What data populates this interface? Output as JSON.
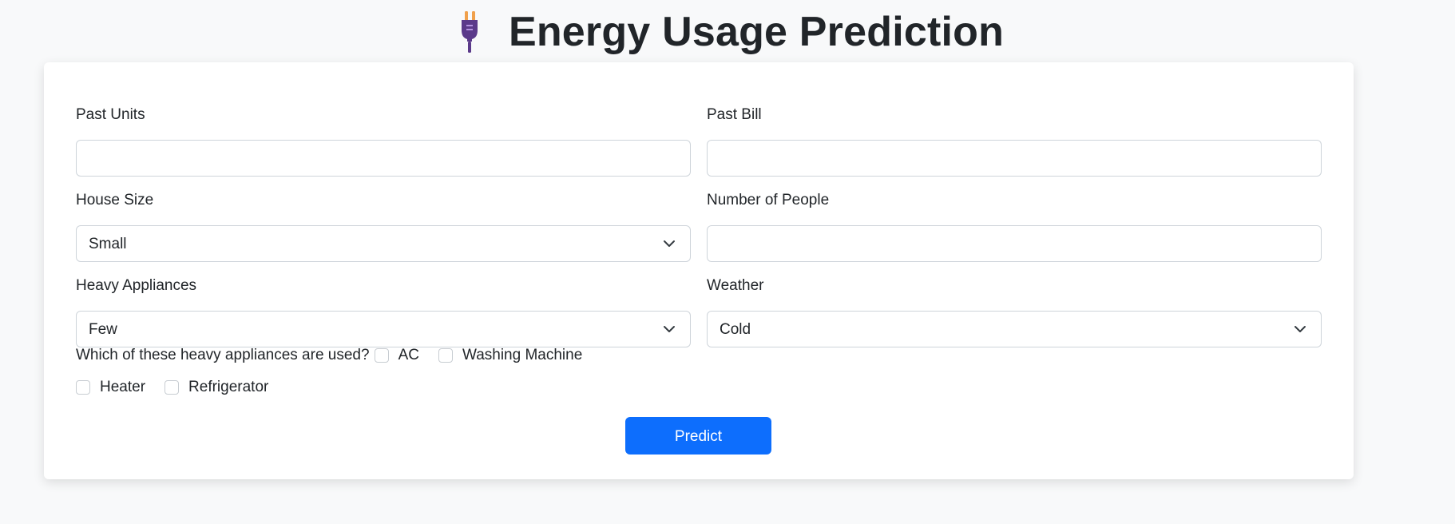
{
  "header": {
    "title": "Energy Usage Prediction",
    "icon": "plug-icon"
  },
  "form": {
    "past_units": {
      "label": "Past Units",
      "value": ""
    },
    "past_bill": {
      "label": "Past Bill",
      "value": ""
    },
    "house_size": {
      "label": "House Size",
      "selected": "Small"
    },
    "number_of_people": {
      "label": "Number of People",
      "value": ""
    },
    "heavy_appliances": {
      "label": "Heavy Appliances",
      "selected": "Few"
    },
    "weather": {
      "label": "Weather",
      "selected": "Cold"
    },
    "appliances_question": "Which of these heavy appliances are used?",
    "appliances": [
      {
        "label": "AC",
        "checked": false
      },
      {
        "label": "Washing Machine",
        "checked": false
      },
      {
        "label": "Heater",
        "checked": false
      },
      {
        "label": "Refrigerator",
        "checked": false
      }
    ],
    "predict_label": "Predict"
  },
  "colors": {
    "primary": "#0d6efd",
    "background": "#f8f9fa",
    "card": "#ffffff",
    "border": "#ced4da",
    "text": "#212529",
    "plug": "#5b3a8a",
    "plug_prongs": "#f0a04b"
  }
}
